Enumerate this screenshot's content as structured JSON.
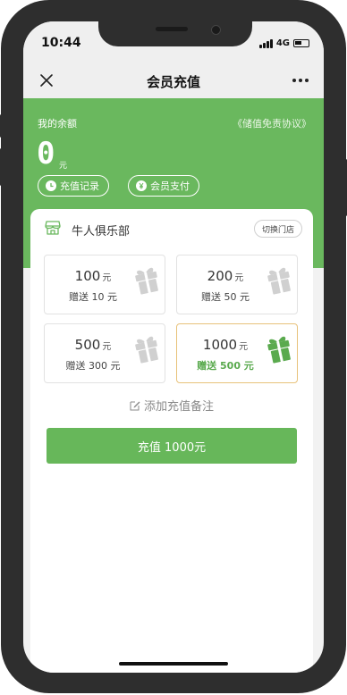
{
  "status_bar": {
    "time": "10:44",
    "network": "4G",
    "battery_level": 0.55
  },
  "nav": {
    "title": "会员充值"
  },
  "balance": {
    "label": "我的余额",
    "value": "0",
    "unit": "元",
    "agreement": "《储值免责协议》"
  },
  "actions": {
    "history_label": "充值记录",
    "member_pay_label": "会员支付"
  },
  "store": {
    "name": "牛人俱乐部",
    "switch_label": "切换门店"
  },
  "options": [
    {
      "amount": "100",
      "unit": "元",
      "bonus": "赠送 10 元",
      "selected": false
    },
    {
      "amount": "200",
      "unit": "元",
      "bonus": "赠送 50 元",
      "selected": false
    },
    {
      "amount": "500",
      "unit": "元",
      "bonus": "赠送 300 元",
      "selected": false
    },
    {
      "amount": "1000",
      "unit": "元",
      "bonus": "赠送 500 元",
      "selected": true
    }
  ],
  "note": {
    "label": "添加充值备注"
  },
  "pay_button": {
    "label": "充值 1000元"
  },
  "colors": {
    "brand_green": "#6ab85e",
    "gift_gray": "#cccccc",
    "gift_green": "#5aaa4e",
    "selected_border": "#e8c27a"
  }
}
